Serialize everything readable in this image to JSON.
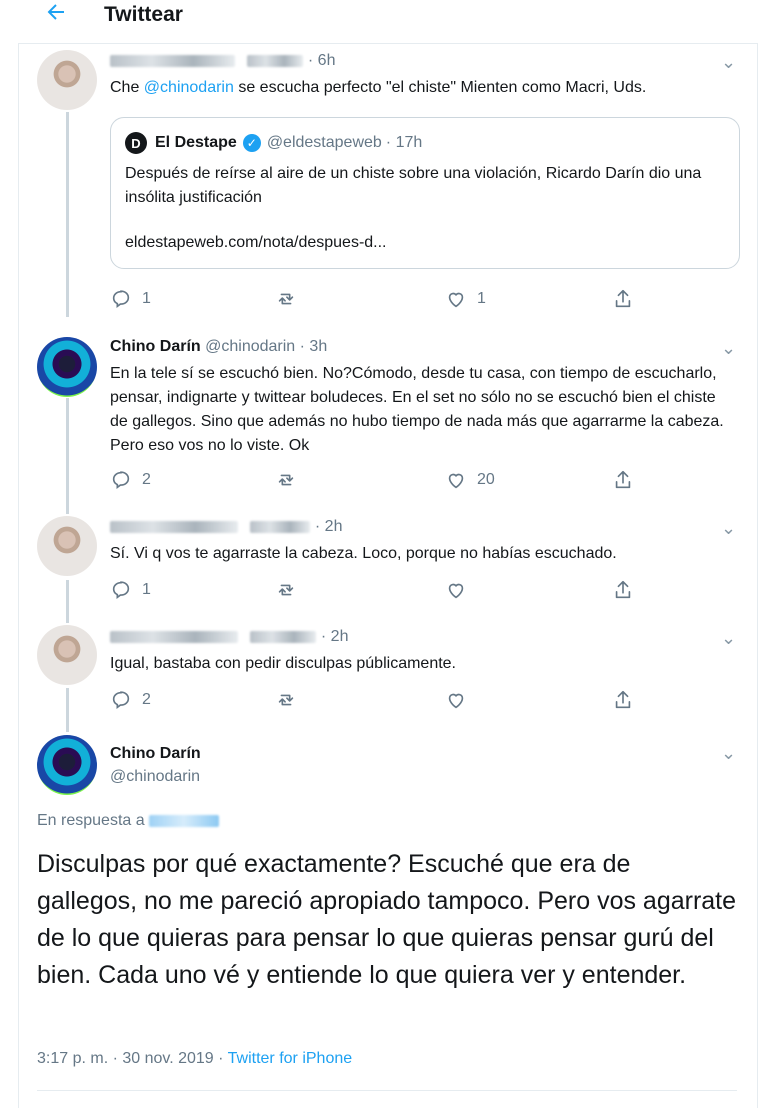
{
  "header": {
    "title": "Twittear",
    "back_icon": "back-arrow-icon"
  },
  "tweets": [
    {
      "user_time": "· 6h",
      "text_before": "Che ",
      "mention": "@chinodarin",
      "text_after": " se escucha perfecto \"el chiste\" Mienten como Macri, Uds.",
      "quote": {
        "name": "El Destape",
        "handle": "@eldestapeweb",
        "time": "· 17h",
        "text": "Después de reírse al aire de un chiste sobre una violación, Ricardo Darín dio una insólita justificación",
        "link": "eldestapeweb.com/nota/despues-d..."
      },
      "replies": "1",
      "retweets": "",
      "likes": "1"
    },
    {
      "name": "Chino Darín",
      "handle": "@chinodarin",
      "time": "· 3h",
      "text": "En la tele sí se escuchó bien. No?Cómodo, desde tu casa, con tiempo de escucharlo, pensar, indignarte y twittear boludeces. En el set no sólo no se escuchó bien el chiste de gallegos. Sino que además no hubo tiempo de nada más que agarrarme la cabeza. Pero eso vos no lo viste. Ok",
      "replies": "2",
      "retweets": "",
      "likes": "20"
    },
    {
      "time": "· 2h",
      "text": "Sí. Vi q vos te agarraste la cabeza. Loco, porque no habías escuchado.",
      "replies": "1",
      "retweets": "",
      "likes": ""
    },
    {
      "time": "· 2h",
      "text": "Igual, bastaba con pedir disculpas públicamente.",
      "replies": "2",
      "retweets": "",
      "likes": ""
    }
  ],
  "main": {
    "name": "Chino Darín",
    "handle": "@chinodarin",
    "reply_label": "En respuesta a",
    "text": "Disculpas por qué exactamente? Escuché que era de gallegos, no me pareció apropiado tampoco. Pero vos agarrate de lo que quieras para pensar lo que quieras pensar gurú del bien. Cada uno vé y entiende lo que quiera ver y entender.",
    "timestamp": "3:17 p. m. · 30 nov. 2019 · ",
    "source": "Twitter for iPhone"
  },
  "colors": {
    "accent": "#1da1f2",
    "text": "#14171a",
    "muted": "#657786",
    "border": "#e6ecf0"
  }
}
